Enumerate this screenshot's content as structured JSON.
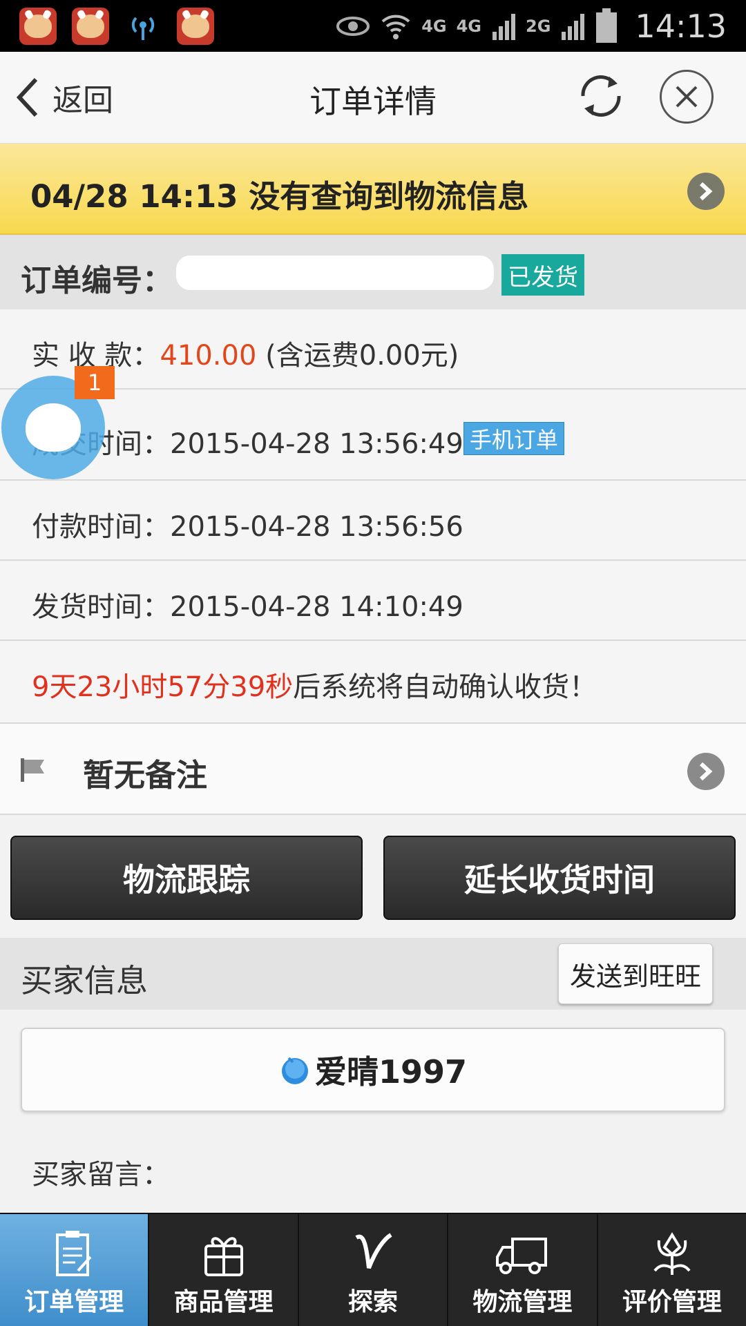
{
  "status_bar": {
    "network_labels": [
      "4G",
      "4G",
      "2G"
    ],
    "time": "14:13",
    "icons": [
      "app-cow-icon",
      "app-cow-icon",
      "signal-tower-icon",
      "app-cow-icon",
      "eye-icon",
      "wifi-icon",
      "signal-icon",
      "battery-icon"
    ]
  },
  "header": {
    "back_label": "返回",
    "title": "订单详情"
  },
  "logistics": {
    "text": "04/28 14:13 没有查询到物流信息"
  },
  "order": {
    "number_label": "订单编号：",
    "status": "已发货"
  },
  "rows": {
    "received_label": "实  收  款：",
    "received_amount": "410.00",
    "received_note": "(含运费0.00元)",
    "created_label": "成交时间：",
    "created_time": "2015-04-28 13:56:49",
    "created_tag": "手机订单",
    "paid_label": "付款时间：",
    "paid_time": "2015-04-28 13:56:56",
    "shipped_label": "发货时间：",
    "shipped_time": "2015-04-28 14:10:49",
    "countdown": "9天23小时57分39秒",
    "countdown_suffix": "后系统将自动确认收货！"
  },
  "remark": {
    "text": "暂无备注"
  },
  "actions": {
    "track_label": "物流跟踪",
    "extend_label": "延长收货时间"
  },
  "buyer": {
    "section_label": "买家信息",
    "send_button": "发送到旺旺",
    "name": "爱晴1997",
    "message_label": "买家留言："
  },
  "floating": {
    "badge": "1"
  },
  "tabs": [
    {
      "label": "订单管理",
      "icon": "clipboard-icon"
    },
    {
      "label": "商品管理",
      "icon": "gift-icon"
    },
    {
      "label": "探索",
      "icon": "v-logo-icon"
    },
    {
      "label": "物流管理",
      "icon": "truck-icon"
    },
    {
      "label": "评价管理",
      "icon": "flower-icon"
    }
  ],
  "colors": {
    "banner_yellow": "#f8d94f",
    "status_teal": "#18a89c",
    "amount_orange": "#e2471b",
    "countdown_red": "#e0301e",
    "active_tab_blue": "#4f9dd6"
  }
}
